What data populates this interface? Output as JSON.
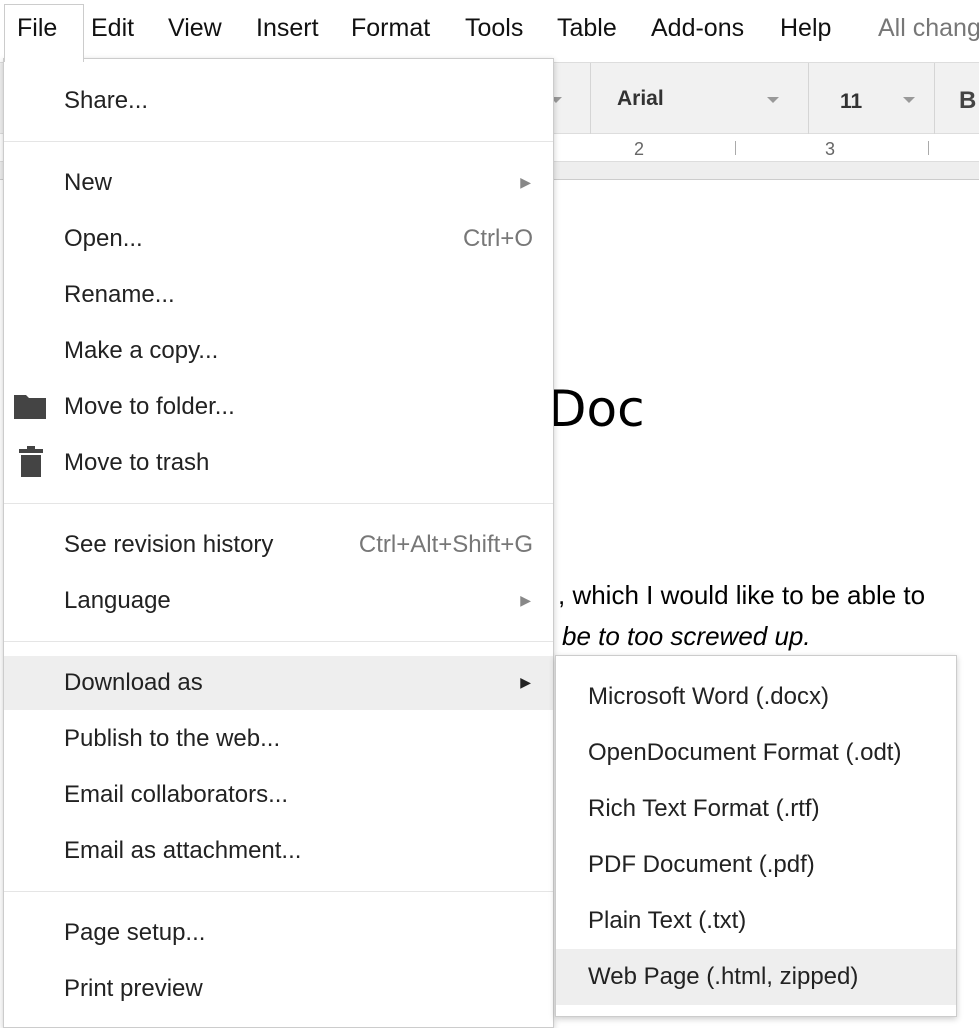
{
  "menubar": {
    "items": [
      "File",
      "Edit",
      "View",
      "Insert",
      "Format",
      "Tools",
      "Table",
      "Add-ons",
      "Help"
    ],
    "status": "All chang"
  },
  "toolbar": {
    "font": "Arial",
    "size": "11",
    "bold": "B"
  },
  "ruler": {
    "labels": [
      "2",
      "3"
    ]
  },
  "document": {
    "title_fragment": "Doc",
    "line1_link_fragment": "·",
    "line1": ", which I would like to be able to",
    "line2": "be to too screwed up."
  },
  "file_menu": {
    "share": "Share...",
    "new": "New",
    "open": "Open...",
    "open_shortcut": "Ctrl+O",
    "rename": "Rename...",
    "copy": "Make a copy...",
    "move_folder": "Move to folder...",
    "trash": "Move to trash",
    "revision": "See revision history",
    "revision_shortcut": "Ctrl+Alt+Shift+G",
    "language": "Language",
    "download": "Download as",
    "publish": "Publish to the web...",
    "email_collab": "Email collaborators...",
    "email_attach": "Email as attachment...",
    "page_setup": "Page setup...",
    "print_preview": "Print preview"
  },
  "download_submenu": [
    "Microsoft Word (.docx)",
    "OpenDocument Format (.odt)",
    "Rich Text Format (.rtf)",
    "PDF Document (.pdf)",
    "Plain Text (.txt)",
    "Web Page (.html, zipped)"
  ],
  "icons": {
    "folder": "folder-icon",
    "trash": "trash-icon",
    "submenu": "triangle-right-icon"
  }
}
